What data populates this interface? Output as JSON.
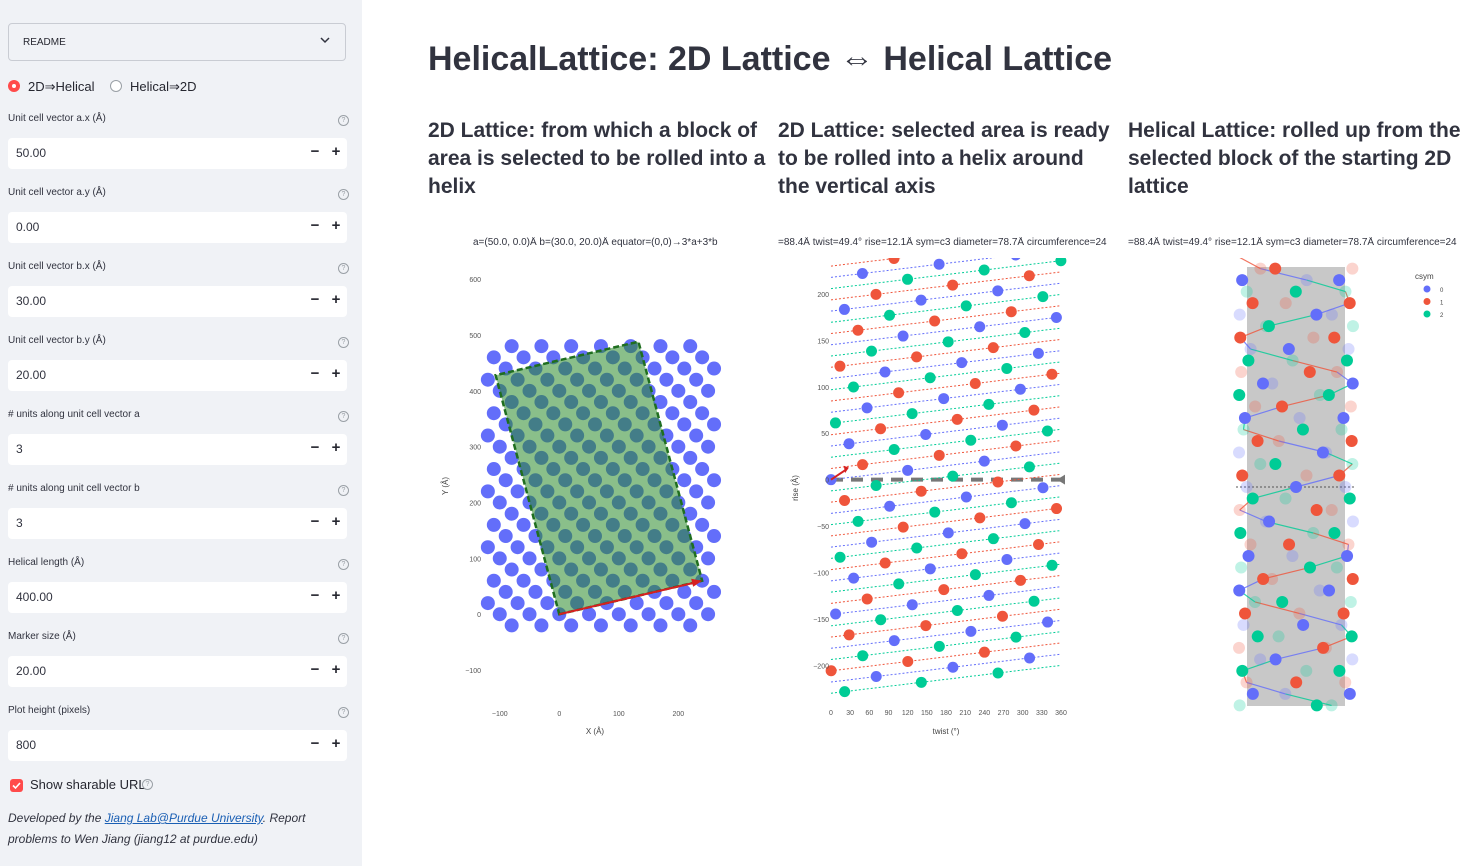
{
  "sidebar": {
    "readme": "README",
    "mode_options": [
      "2D⇒Helical",
      "Helical⇒2D"
    ],
    "mode_selected": 0,
    "fields": [
      {
        "label": "Unit cell vector a.x (Å)",
        "value": "50.00"
      },
      {
        "label": "Unit cell vector a.y (Å)",
        "value": "0.00"
      },
      {
        "label": "Unit cell vector b.x (Å)",
        "value": "30.00"
      },
      {
        "label": "Unit cell vector b.y (Å)",
        "value": "20.00"
      },
      {
        "label": "# units along unit cell vector a",
        "value": "3"
      },
      {
        "label": "# units along unit cell vector b",
        "value": "3"
      },
      {
        "label": "Helical length (Å)",
        "value": "400.00"
      },
      {
        "label": "Marker size (Å)",
        "value": "20.00"
      },
      {
        "label": "Plot height (pixels)",
        "value": "800"
      }
    ],
    "minus_symbol": "−",
    "plus_symbol": "+",
    "help_symbol": "?",
    "share_label": "Show sharable URL",
    "share_checked": true,
    "footer_prefix": "Developed by the ",
    "footer_link": "Jiang Lab@Purdue University",
    "footer_suffix": ". Report problems to Wen Jiang (jiang12 at purdue.edu)"
  },
  "main": {
    "title": "HelicalLattice: 2D Lattice ⇔ Helical Lattice",
    "columns": [
      "2D Lattice: from which a block of area is selected to be rolled into a helix",
      "2D Lattice: selected area is ready to be rolled into a helix around the vertical axis",
      "Helical Lattice: rolled up from the selected block of the starting 2D lattice"
    ]
  },
  "colors": {
    "accent": "#ff4b4b",
    "c0": "#636efa",
    "c1": "#ef553b",
    "c2": "#00cc96",
    "link": "#1a5fb4"
  },
  "chart_data": [
    {
      "type": "scatter",
      "title": "a=(50.0, 0.0)Å b=(30.0, 20.0)Å equator=(0,0)→3*a+3*b",
      "xlabel": "X (Å)",
      "ylabel": "Y (Å)",
      "xlim": [
        -150,
        270
      ],
      "ylim": [
        -150,
        620
      ],
      "xticks": [
        -100,
        0,
        100,
        200
      ],
      "yticks": [
        -100,
        0,
        100,
        200,
        300,
        400,
        500,
        600
      ],
      "lattice": {
        "a": [
          50,
          0
        ],
        "b": [
          30,
          20
        ],
        "xrange": [
          -125,
          265
        ],
        "yrange": [
          -20,
          480
        ]
      },
      "selection": [
        [
          0,
          0
        ],
        [
          240,
          60
        ],
        [
          133,
          488
        ],
        [
          -107,
          428
        ]
      ],
      "equator_vector": [
        [
          0,
          0
        ],
        [
          240,
          60
        ]
      ],
      "grid": false
    },
    {
      "type": "scatter",
      "title": "=88.4Å twist=49.4° rise=12.1Å sym=c3 diameter=78.7Å circumference=24",
      "xlabel": "twist (°)",
      "ylabel": "rise (Å)",
      "xlim": [
        0,
        360
      ],
      "ylim": [
        -235,
        230
      ],
      "xticks": [
        0,
        30,
        60,
        90,
        120,
        150,
        180,
        210,
        240,
        270,
        300,
        330,
        360
      ],
      "yticks": [
        -200,
        -150,
        -100,
        -50,
        0,
        50,
        100,
        150,
        200
      ],
      "twist": 49.4,
      "rise": 12.1,
      "csym": 3,
      "grid": false
    },
    {
      "type": "line",
      "title": "=88.4Å twist=49.4° rise=12.1Å sym=c3 diameter=78.7Å circumference=24",
      "legend_title": "csym",
      "legend": [
        "0",
        "1",
        "2"
      ],
      "legend_position": "top-right",
      "twist": 49.4,
      "rise": 12.1,
      "csym": 3,
      "diameter": 78.7,
      "grid": false
    }
  ]
}
